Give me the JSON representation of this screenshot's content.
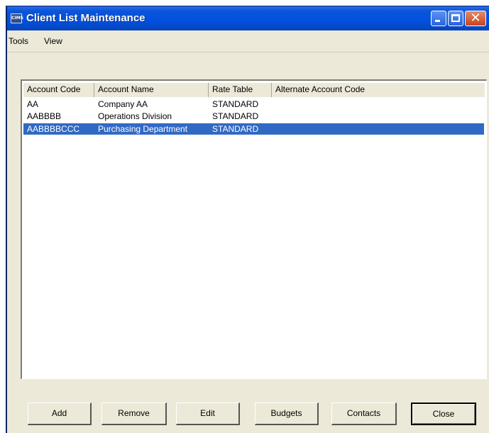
{
  "window": {
    "title": "Client List Maintenance",
    "icon_text": "CIMS",
    "icon_name": "app-icon"
  },
  "menu": {
    "items": [
      "Tools",
      "View"
    ]
  },
  "table": {
    "columns": [
      "Account Code",
      "Account Name",
      "Rate Table",
      "Alternate Account Code"
    ],
    "rows": [
      {
        "account_code": "AA",
        "account_name": "Company AA",
        "rate_table": "STANDARD",
        "alternate_code": ""
      },
      {
        "account_code": "AABBBB",
        "account_name": "Operations Division",
        "rate_table": "STANDARD",
        "alternate_code": ""
      },
      {
        "account_code": "AABBBBCCC",
        "account_name": "Purchasing Department",
        "rate_table": "STANDARD",
        "alternate_code": "",
        "selected": true
      }
    ],
    "selection_color": "#316ac5"
  },
  "buttons": {
    "add": "Add",
    "remove": "Remove",
    "edit": "Edit",
    "budgets": "Budgets",
    "contacts": "Contacts",
    "close": "Close"
  },
  "colors": {
    "titlebar": "#0051e0",
    "window_bg": "#ece9d8",
    "close_button": "#c8431e"
  }
}
